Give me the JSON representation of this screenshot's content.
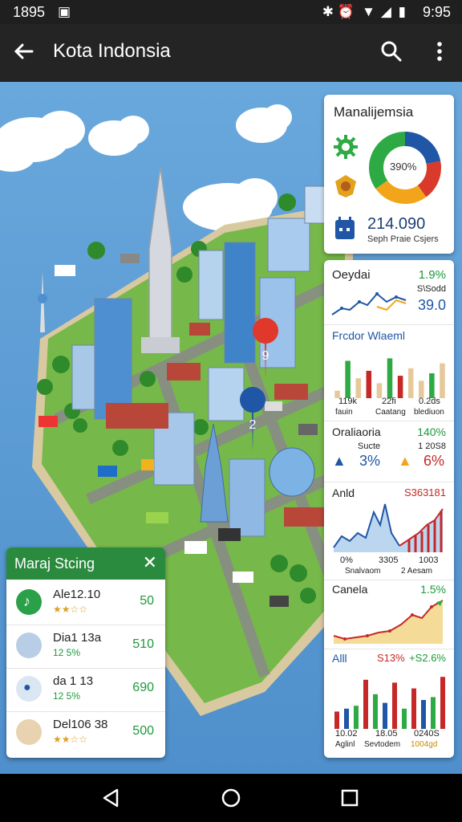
{
  "status_bar": {
    "left_time": "1895",
    "right_time": "9:95"
  },
  "app_bar": {
    "title": "Kota Indonsia",
    "back_icon": "arrow-left-icon",
    "search_icon": "search-icon",
    "menu_icon": "more-vert-icon"
  },
  "map": {
    "pin_1_label": "9",
    "pin_2_label": "2"
  },
  "donut_card": {
    "title": "Manalijemsia",
    "center_label": "390%",
    "value": "214.090",
    "caption": "Seph Praie Csjers",
    "segments": [
      {
        "color": "#1f56a6",
        "share": 0.22
      },
      {
        "color": "#d93a2b",
        "share": 0.18
      },
      {
        "color": "#f2a51a",
        "share": 0.25
      },
      {
        "color": "#2eaa44",
        "share": 0.35
      }
    ]
  },
  "panel": {
    "s1": {
      "label": "Oeydai",
      "pct": "1.9%",
      "sub": "S\\Sodd",
      "val": "39.0"
    },
    "s2": {
      "label": "Frcdor Wlaeml",
      "x1": "119k",
      "x2": "22fi",
      "x3": "0.2ds",
      "x4": "fauin",
      "x5": "Caatang",
      "x6": "blediuon"
    },
    "s3": {
      "label": "Oraliaoria",
      "pct": "140%",
      "sub1": "Sucte",
      "sub2": "1 20S8",
      "v1": "3%",
      "v2": "6%"
    },
    "s4": {
      "label": "Anld",
      "pct": "S363181",
      "x1": "0%",
      "x2": "3305",
      "x3": "1003",
      "x4": "Snalvaom",
      "x5": "2 Aesam"
    },
    "s5": {
      "label": "Canela",
      "pct": "1.5%"
    },
    "s6": {
      "label": "Alll",
      "p1": "S13%",
      "p2": "+S2.6%",
      "x1": "10.02",
      "x2": "18.05",
      "x3": "0240S",
      "x4": "Aglinl",
      "x5": "Sevtodem",
      "x6": "1004gd"
    }
  },
  "list": {
    "title": "Maraj Stcing",
    "close_icon": "close-icon",
    "items": [
      {
        "name": "Ale12.10",
        "sub": "★★☆☆",
        "value": "50"
      },
      {
        "name": "Dia1 13a",
        "sub": "12 5%",
        "value": "510"
      },
      {
        "name": "da 1 13",
        "sub": "12 5%",
        "value": "690"
      },
      {
        "name": "Del106 38",
        "sub": "★★☆☆",
        "value": "500"
      }
    ]
  },
  "charts": {
    "bars_s2": [
      0.15,
      0.75,
      0.4,
      0.55,
      0.3,
      0.8,
      0.45,
      0.6,
      0.35,
      0.5,
      0.7
    ],
    "bars_s6": [
      0.3,
      0.35,
      0.4,
      0.85,
      0.6,
      0.45,
      0.8,
      0.35,
      0.7,
      0.5,
      0.55,
      0.9
    ]
  }
}
